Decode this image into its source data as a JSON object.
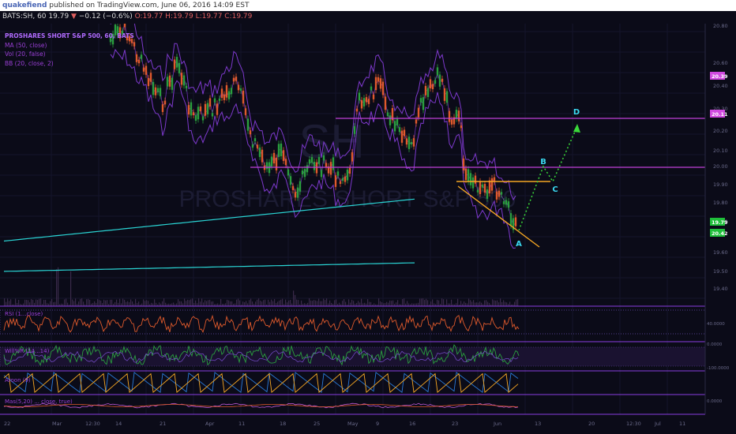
{
  "header": {
    "author": "quakefiend",
    "published": "published on TradingView.com, June 06, 2016 14:09 EST"
  },
  "symbol_line": {
    "symbol": "BATS:SH, 60",
    "last": "19.79",
    "change": "−0.12 (−0.6%)",
    "ohlc": "O:19.77  H:19.79  L:19.77  C:19.79"
  },
  "legend": {
    "title": "PROSHARES SHORT S&P 500, 60, BATS",
    "ma": "MA (50, close)",
    "vol": "Vol (20, false)",
    "bb": "BB (20, close, 2)",
    "rsi": "RSI (1...close)",
    "willr": "Will%R (14...14)",
    "aroon": "Aroon (9)",
    "extra": "Mas(5,20) ... close, true)"
  },
  "watermark": {
    "symbol": "SH",
    "name": "PROSHARES SHORT S&P 500"
  },
  "colors": {
    "background": "#0b0b18",
    "candle_up": "#2a9f3e",
    "candle_down": "#e05a2c",
    "bands": "#8a3ee0",
    "ma": "#2ad4d4",
    "hline": "#c040d8",
    "wedge": "#f5a623",
    "projection": "#3ad83a",
    "wave_labels": "#3ad8f0"
  },
  "price_axis": {
    "ticks": [
      "20.80",
      "20.60",
      "20.40",
      "20.30",
      "20.20",
      "20.10",
      "20.00",
      "19.90",
      "19.80",
      "19.70",
      "19.60",
      "19.50",
      "19.40"
    ],
    "badges": [
      {
        "text": "20.39",
        "kind": "band"
      },
      {
        "text": "20.11",
        "kind": "level"
      },
      {
        "text": "19.79",
        "kind": "last"
      },
      {
        "text": "20.42",
        "kind": "ma"
      }
    ]
  },
  "time_axis": {
    "labels": [
      "22",
      "Mar",
      "12:30",
      "14",
      "21",
      "Apr",
      "11",
      "18",
      "25",
      "May",
      "9",
      "16",
      "23",
      "Jun",
      "13",
      "20",
      "12:30",
      "Jul",
      "11"
    ]
  },
  "wave_labels": [
    "A",
    "B",
    "C",
    "D"
  ],
  "osc_axis": {
    "rsi": "40.0000",
    "willr_top": "0.0000",
    "willr_bottom": "-100.0000",
    "aroon": "0.0000"
  }
}
